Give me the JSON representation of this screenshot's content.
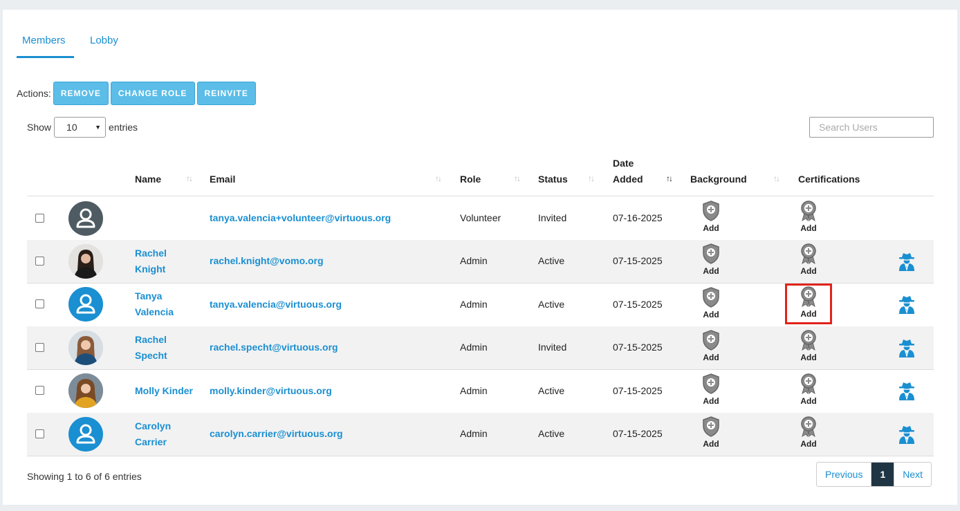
{
  "tabs": [
    {
      "label": "Members"
    },
    {
      "label": "Lobby"
    }
  ],
  "actions": {
    "label": "Actions:",
    "buttons": [
      "REMOVE",
      "CHANGE ROLE",
      "REINVITE"
    ]
  },
  "length_menu": {
    "prefix": "Show",
    "value": "10",
    "suffix": "entries"
  },
  "search": {
    "placeholder": "Search Users"
  },
  "columns": {
    "name": "Name",
    "email": "Email",
    "role": "Role",
    "status": "Status",
    "date_line1": "Date",
    "date_line2": "Added",
    "background": "Background",
    "certifications": "Certifications"
  },
  "add_label": "Add",
  "rows": [
    {
      "name1": "",
      "name2": "",
      "email": "tanya.valencia+volunteer@virtuous.org",
      "role": "Volunteer",
      "status": "Invited",
      "date": "07-16-2025",
      "avatar": "default-gray"
    },
    {
      "name1": "Rachel",
      "name2": "Knight",
      "email": "rachel.knight@vomo.org",
      "role": "Admin",
      "status": "Active",
      "date": "07-15-2025",
      "avatar": "photo"
    },
    {
      "name1": "Tanya",
      "name2": "Valencia",
      "email": "tanya.valencia@virtuous.org",
      "role": "Admin",
      "status": "Active",
      "date": "07-15-2025",
      "avatar": "default-blue"
    },
    {
      "name1": "Rachel",
      "name2": "Specht",
      "email": "rachel.specht@virtuous.org",
      "role": "Admin",
      "status": "Invited",
      "date": "07-15-2025",
      "avatar": "photo"
    },
    {
      "name1": "Molly Kinder",
      "name2": "",
      "email": "molly.kinder@virtuous.org",
      "role": "Admin",
      "status": "Active",
      "date": "07-15-2025",
      "avatar": "photo"
    },
    {
      "name1": "Carolyn",
      "name2": "Carrier",
      "email": "carolyn.carrier@virtuous.org",
      "role": "Admin",
      "status": "Active",
      "date": "07-15-2025",
      "avatar": "default-blue"
    }
  ],
  "footer": {
    "info": "Showing 1 to 6 of 6 entries",
    "previous": "Previous",
    "page": "1",
    "next": "Next"
  },
  "colors": {
    "accent": "#1a8fd1",
    "button": "#5bbde8",
    "highlight": "#e0231b",
    "pager_active": "#1f3544"
  }
}
